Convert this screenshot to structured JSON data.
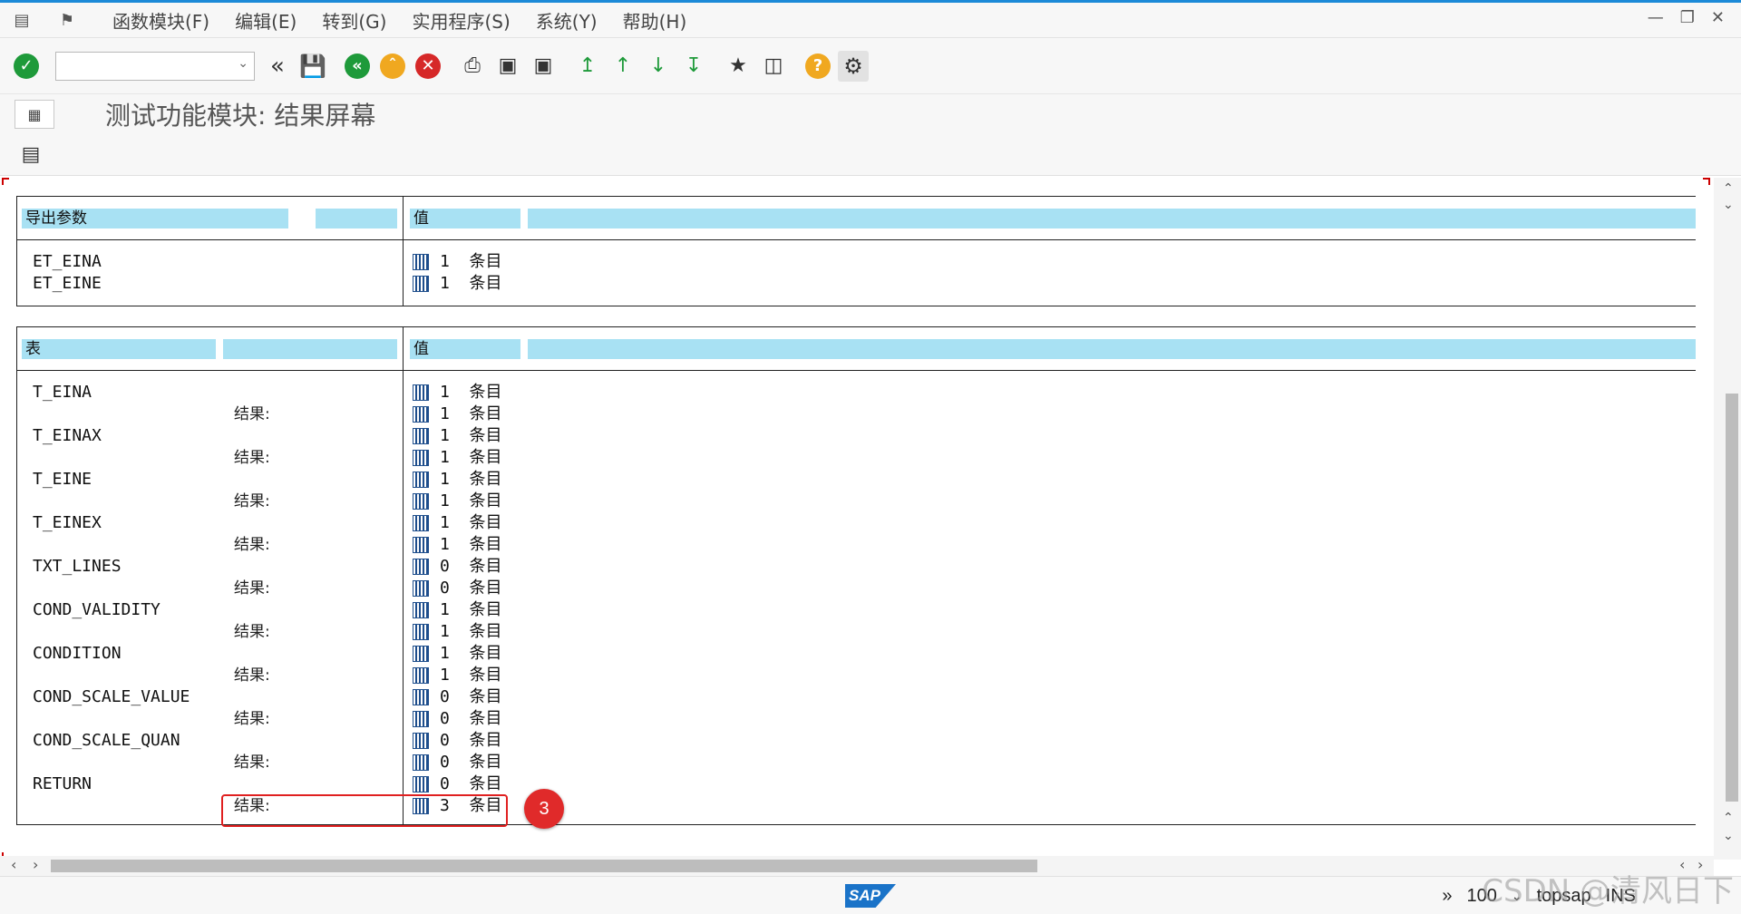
{
  "menu": {
    "items": [
      "函数模块(F)",
      "编辑(E)",
      "转到(G)",
      "实用程序(S)",
      "系统(Y)",
      "帮助(H)"
    ]
  },
  "toolbar": {
    "command_value": "",
    "icons": [
      "check-icon",
      "back-double-icon",
      "save-icon",
      "back-icon",
      "exit-icon",
      "cancel-icon",
      "print-icon",
      "find-icon",
      "find-next-icon",
      "first-page-icon",
      "prev-page-icon",
      "next-page-icon",
      "last-page-icon",
      "new-session-icon",
      "shortcut-icon",
      "help-icon",
      "settings-icon"
    ]
  },
  "title": "测试功能模块: 结果屏幕",
  "export_section": {
    "header_left": "导出参数",
    "header_value": "值",
    "rows": [
      {
        "name": "ET_EINA",
        "count": "1",
        "unit": "条目"
      },
      {
        "name": "ET_EINE",
        "count": "1",
        "unit": "条目"
      }
    ]
  },
  "tables_section": {
    "header_left": "表",
    "header_value": "值",
    "result_label": "结果:",
    "rows": [
      {
        "name": "T_EINA",
        "count": "1",
        "result_count": "1"
      },
      {
        "name": "T_EINAX",
        "count": "1",
        "result_count": "1"
      },
      {
        "name": "T_EINE",
        "count": "1",
        "result_count": "1"
      },
      {
        "name": "T_EINEX",
        "count": "1",
        "result_count": "1"
      },
      {
        "name": "TXT_LINES",
        "count": "0",
        "result_count": "0"
      },
      {
        "name": "COND_VALIDITY",
        "count": "1",
        "result_count": "1"
      },
      {
        "name": "CONDITION",
        "count": "1",
        "result_count": "1"
      },
      {
        "name": "COND_SCALE_VALUE",
        "count": "0",
        "result_count": "0"
      },
      {
        "name": "COND_SCALE_QUAN",
        "count": "0",
        "result_count": "0"
      },
      {
        "name": "RETURN",
        "count": "0",
        "result_count": "3"
      }
    ],
    "unit": "条目"
  },
  "annotation": {
    "badge": "3"
  },
  "status": {
    "logo": "SAP",
    "zoom": "100",
    "system": "topsap",
    "mode": "INS"
  },
  "watermark": "CSDN @清风日下"
}
